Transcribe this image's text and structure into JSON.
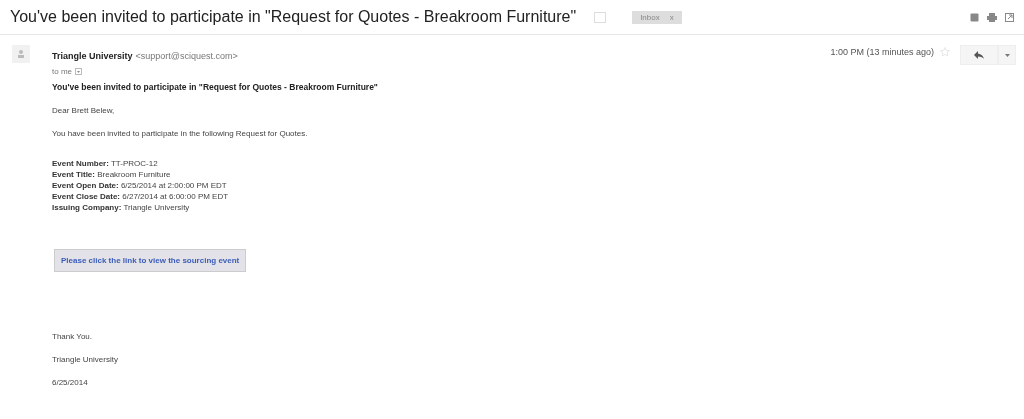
{
  "subject": "You've been invited to participate in \"Request for Quotes - Breakroom Furniture\"",
  "label": {
    "text": "Inbox",
    "close": "x"
  },
  "sender": {
    "name": "Triangle University",
    "email": "<support@sciquest.com>",
    "to": "to me",
    "time": "1:00 PM (13 minutes ago)",
    "starred": false
  },
  "body": {
    "heading": "You've been invited to participate in \"Request for Quotes - Breakroom Furniture\"",
    "greeting": "Dear Brett Belew,",
    "intro": "You have been invited to participate in the following Request for Quotes.",
    "details": [
      "**Event Number:** TT-PROC-12",
      "**Event Title:** Breakroom Furniture",
      "**Event Open Date:** 6/25/2014 at 2:00:00 PM EDT",
      "**Event Close Date:** 6/27/2014 at 6:00:00 PM EDT",
      "**Issuing Company:** Triangle University"
    ],
    "link": "Please click the link to view the sourcing event",
    "closing": [
      "Thank You.",
      "Triangle University",
      "6/25/2014"
    ]
  }
}
